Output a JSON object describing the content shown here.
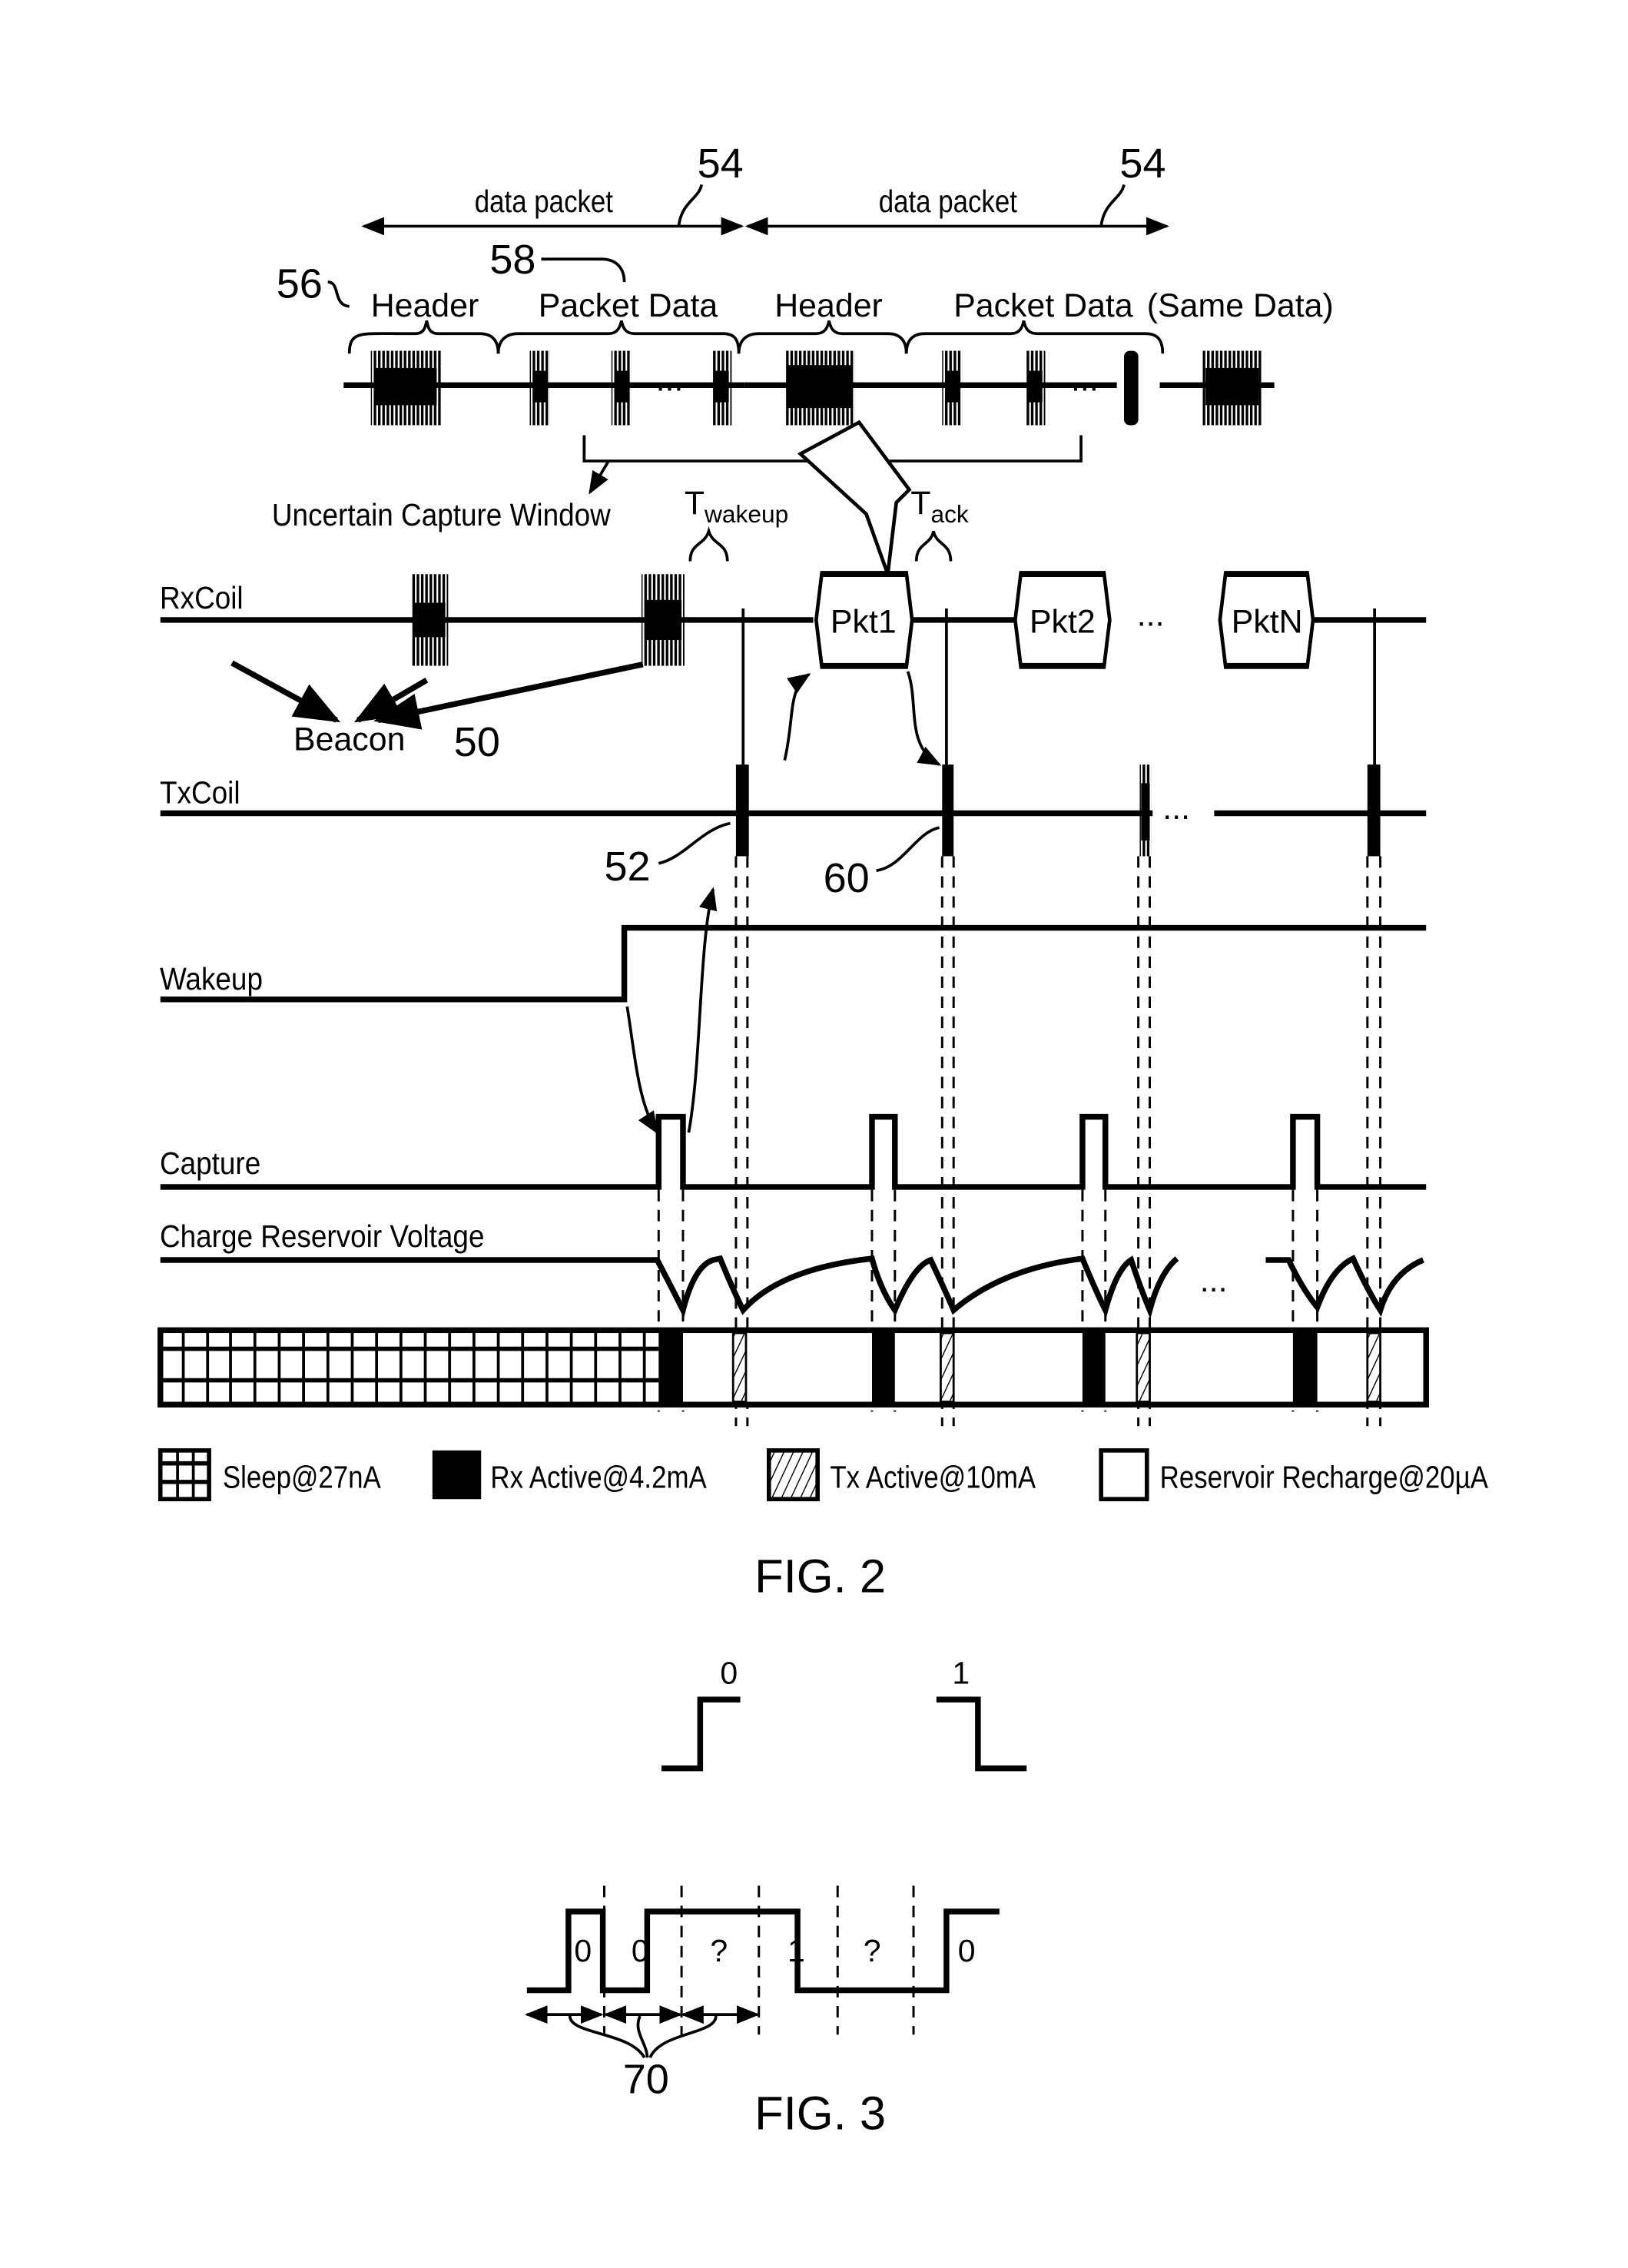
{
  "fig2": {
    "title": "FIG. 2",
    "top": {
      "data_packet_label_1": "data packet",
      "data_packet_label_2": "data packet",
      "ref_54_a": "54",
      "ref_54_b": "54",
      "ref_56": "56",
      "ref_58": "58",
      "segments": [
        "Header",
        "Packet Data",
        "Header",
        "Packet Data"
      ],
      "same_data": "(Same Data)",
      "ellipsis": "...",
      "uncertain_capture_window": "Uncertain Capture Window",
      "t_wakeup": "T",
      "t_wakeup_sub": "wakeup",
      "t_ack": "T",
      "t_ack_sub": "ack"
    },
    "signals": {
      "rxcoil": "RxCoil",
      "txcoil": "TxCoil",
      "wakeup": "Wakeup",
      "capture": "Capture",
      "charge_reservoir": "Charge Reservoir Voltage"
    },
    "packets": [
      "Pkt1",
      "Pkt2",
      "PktN"
    ],
    "beacon_label": "Beacon",
    "ref_50": "50",
    "ref_52": "52",
    "ref_60": "60",
    "ellipsis": "...",
    "legend": [
      {
        "label": "Sleep@27nA",
        "pattern": "grid"
      },
      {
        "label": "Rx Active@4.2mA",
        "pattern": "solid"
      },
      {
        "label": "Tx Active@10mA",
        "pattern": "hatch"
      },
      {
        "label": "Reservoir Recharge@20µA",
        "pattern": "empty"
      }
    ]
  },
  "fig3": {
    "title": "FIG. 3",
    "symbol_0": "0",
    "symbol_1": "1",
    "bit_labels": [
      "0",
      "0",
      "?",
      "1",
      "?",
      "0"
    ],
    "ref_70": "70"
  }
}
